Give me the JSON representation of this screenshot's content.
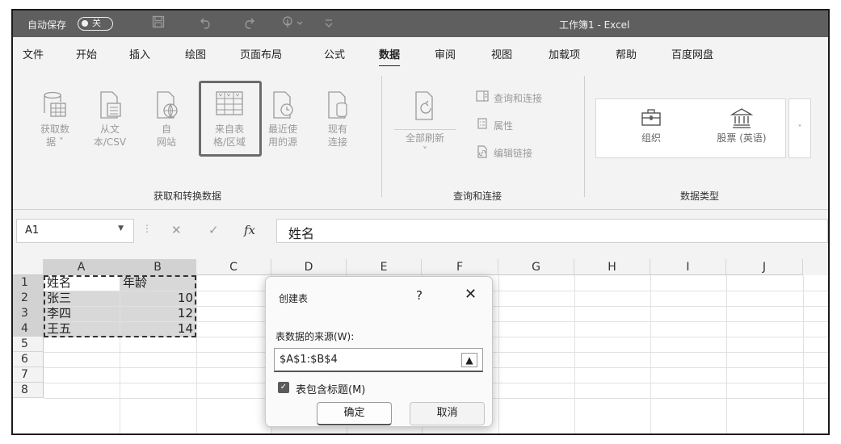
{
  "titlebar": {
    "autosave_label": "自动保存",
    "autosave_state": "关",
    "window_title": "工作簿1 - Excel"
  },
  "menu": [
    "文件",
    "开始",
    "插入",
    "绘图",
    "页面布局",
    "公式",
    "数据",
    "审阅",
    "视图",
    "加载项",
    "帮助",
    "百度网盘"
  ],
  "menu_active": "数据",
  "ribbon": {
    "get_data": [
      "获取数",
      "据 ˅"
    ],
    "from_text": [
      "从文",
      "本/CSV"
    ],
    "from_web": [
      "自",
      "网站"
    ],
    "from_table": [
      "来自表",
      "格/区域"
    ],
    "recent_sources": [
      "最近使",
      "用的源"
    ],
    "existing_conn": [
      "现有",
      "连接"
    ],
    "group1_label": "获取和转换数据",
    "refresh_all": "全部刷新",
    "queries_conn": "查询和连接",
    "properties": "属性",
    "edit_links": "编辑链接",
    "group2_label": "查询和连接",
    "org": "组织",
    "stocks": "股票 (英语)",
    "group3_label": "数据类型"
  },
  "formula_bar": {
    "name_box": "A1",
    "fx": "fx",
    "value": "姓名"
  },
  "grid": {
    "columns": [
      "A",
      "B",
      "C",
      "D",
      "E",
      "F",
      "G",
      "H",
      "I",
      "J"
    ],
    "rows": [
      "1",
      "2",
      "3",
      "4",
      "5",
      "6",
      "7",
      "8"
    ],
    "cells": {
      "A1": "姓名",
      "B1": "年龄",
      "A2": "张三",
      "B2": "10",
      "A3": "李四",
      "B3": "12",
      "A4": "王五",
      "B4": "14"
    }
  },
  "dialog": {
    "title": "创建表",
    "help": "?",
    "close": "✕",
    "source_label": "表数据的来源(W):",
    "range_value": "$A$1:$B$4",
    "has_headers_label": "表包含标题(M)",
    "has_headers_checked": true,
    "ok": "确定",
    "cancel": "取消"
  }
}
